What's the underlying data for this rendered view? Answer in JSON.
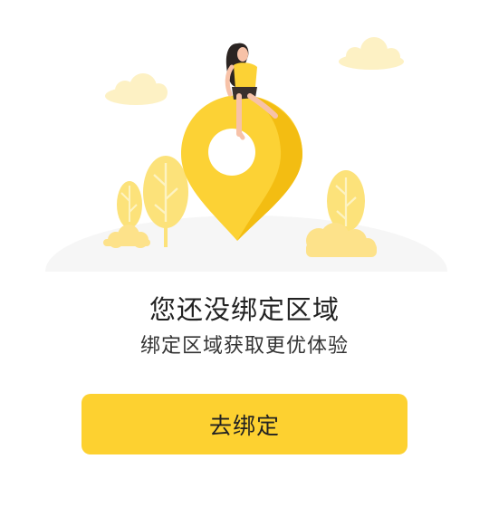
{
  "empty_state": {
    "title": "您还没绑定区域",
    "subtitle": "绑定区域获取更优体验",
    "illustration_icon": "location-pin-with-person-illustration"
  },
  "actions": {
    "bind_label": "去绑定"
  },
  "colors": {
    "accent": "#fdd130",
    "pin": "#fcd235",
    "pin_shadow": "#f3bd12",
    "tree": "#fce27a",
    "cloud": "#fdf1c4",
    "ground": "#f6f6f6",
    "title_text": "#222222"
  }
}
